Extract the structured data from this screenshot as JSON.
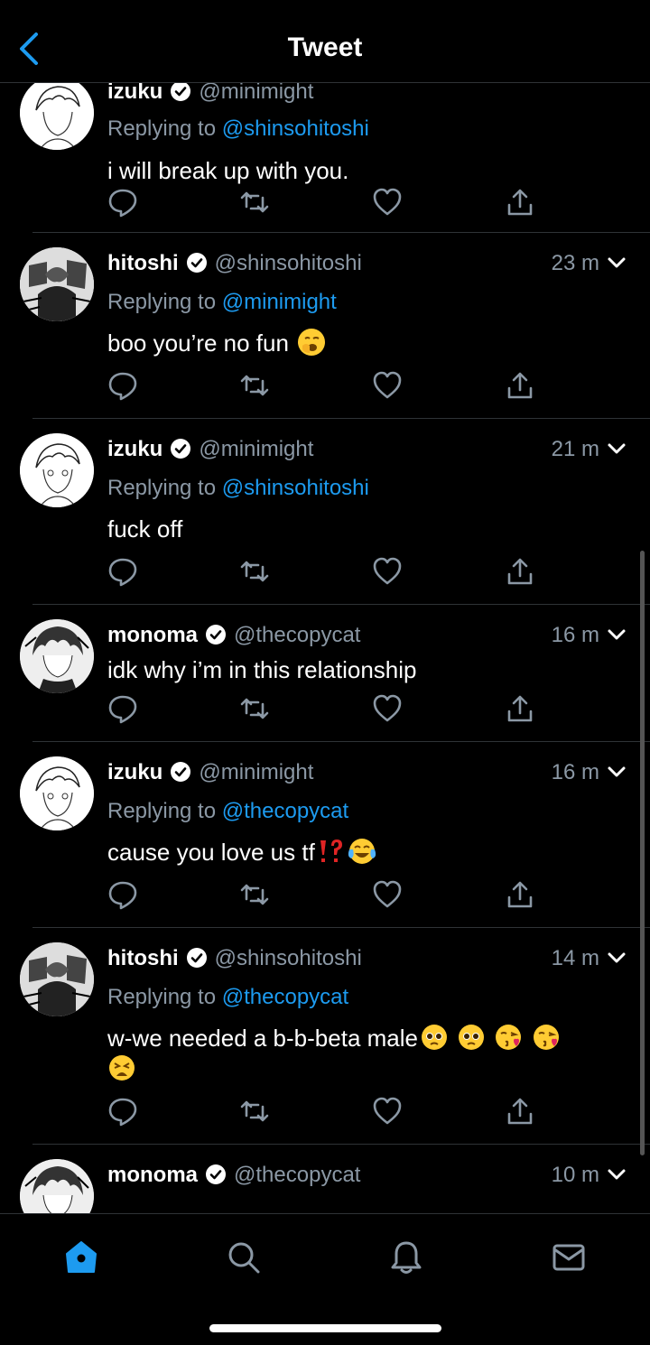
{
  "header": {
    "title": "Tweet",
    "back_icon": "chevron-left-icon"
  },
  "colors": {
    "accent": "#1d9bf0",
    "muted": "#8b98a5",
    "divider": "#2f3336",
    "background": "#000000"
  },
  "tweets": [
    {
      "name": "izuku",
      "handle": "@minimight",
      "time": "",
      "replying_prefix": "Replying to",
      "replying_to": "@shinsohitoshi",
      "text": "i will break up with you.",
      "emojis": []
    },
    {
      "name": "hitoshi",
      "handle": "@shinsohitoshi",
      "time": "23 m",
      "replying_prefix": "Replying to",
      "replying_to": "@minimight",
      "text": "boo you’re no fun",
      "emojis": [
        "yawning-face"
      ]
    },
    {
      "name": "izuku",
      "handle": "@minimight",
      "time": "21 m",
      "replying_prefix": "Replying to",
      "replying_to": "@shinsohitoshi",
      "text": "fuck off",
      "emojis": []
    },
    {
      "name": "monoma",
      "handle": "@thecopycat",
      "time": "16 m",
      "text": "idk why i’m in this relationship",
      "emojis": []
    },
    {
      "name": "izuku",
      "handle": "@minimight",
      "time": "16 m",
      "replying_prefix": "Replying to",
      "replying_to": "@thecopycat",
      "text": "cause you love us tf",
      "emojis": [
        "double-exclamation-question",
        "laughing-crying-face"
      ]
    },
    {
      "name": "hitoshi",
      "handle": "@shinsohitoshi",
      "time": "14 m",
      "replying_prefix": "Replying to",
      "replying_to": "@thecopycat",
      "text": "w-we needed a b-b-beta male",
      "emojis": [
        "pleading-face",
        "pleading-face",
        "kissing-heart-face",
        "kissing-heart-face",
        "weary-face"
      ]
    },
    {
      "name": "monoma",
      "handle": "@thecopycat",
      "time": "10 m",
      "text": "",
      "emojis": []
    }
  ],
  "tabbar": {
    "items": [
      "home-icon",
      "search-icon",
      "notifications-icon",
      "messages-icon"
    ],
    "active": "home-icon"
  }
}
